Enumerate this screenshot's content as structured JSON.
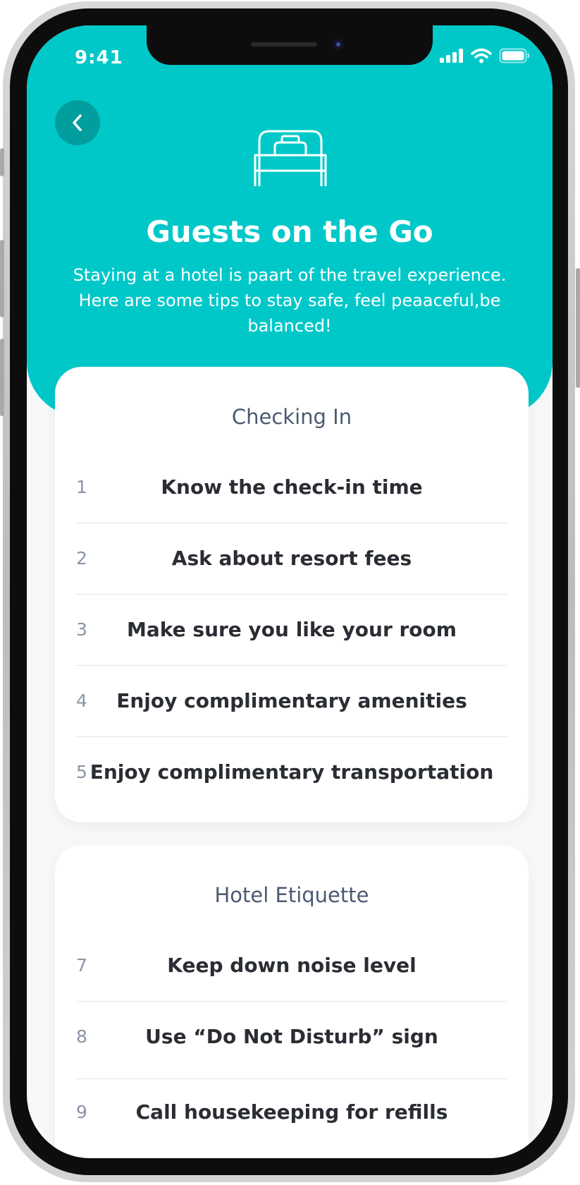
{
  "status_bar": {
    "time": "9:41"
  },
  "header": {
    "icon": "bed-icon",
    "title": "Guests on the Go",
    "subtitle": "Staying at a hotel is paart of the travel experience. Here are some tips to stay safe, feel peaaceful,be balanced!"
  },
  "sections": [
    {
      "title": "Checking In",
      "items": [
        {
          "num": "1",
          "label": "Know the check-in time"
        },
        {
          "num": "2",
          "label": "Ask about resort fees"
        },
        {
          "num": "3",
          "label": "Make sure you like your room"
        },
        {
          "num": "4",
          "label": "Enjoy complimentary amenities"
        },
        {
          "num": "5",
          "label": "Enjoy complimentary transportation"
        }
      ]
    },
    {
      "title": "Hotel Etiquette",
      "items": [
        {
          "num": "7",
          "label": "Keep down noise level"
        },
        {
          "num": "8",
          "label": "Use “Do Not Disturb” sign"
        },
        {
          "num": "9",
          "label": "Call housekeeping for refills"
        }
      ]
    }
  ],
  "colors": {
    "accent": "#00c8c9",
    "back_button": "#029e9e",
    "text_dark": "#2a2d33",
    "section_title": "#4a5a72"
  }
}
